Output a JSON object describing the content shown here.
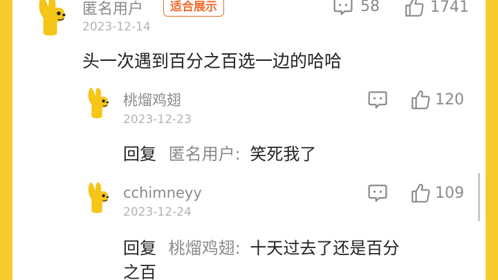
{
  "comments": [
    {
      "username": "匿名用户",
      "badge": "适合展示",
      "date": "2023-12-14",
      "reply_count": "58",
      "like_count": "1741",
      "text": "头一次遇到百分之百选一边的哈哈"
    }
  ],
  "replies": [
    {
      "username": "桃熘鸡翅",
      "date": "2023-12-23",
      "reply_count": "",
      "like_count": "120",
      "prefix": "回复",
      "target": "匿名用户",
      "text": "笑死我了"
    },
    {
      "username": "cchimneyy",
      "date": "2023-12-24",
      "reply_count": "",
      "like_count": "109",
      "prefix": "回复",
      "target": "桃熘鸡翅",
      "text_line1": "十天过去了还是百分",
      "text_line2": "之百"
    }
  ],
  "icons": {
    "comment": "comment-icon",
    "like": "thumbs-up-icon",
    "avatar": "yellow-dog-avatar"
  },
  "colors": {
    "background": "#F7CB2E",
    "badge": "#f06a2a",
    "secondary_text": "#8a8a8a",
    "date_text": "#b3b3b3"
  }
}
